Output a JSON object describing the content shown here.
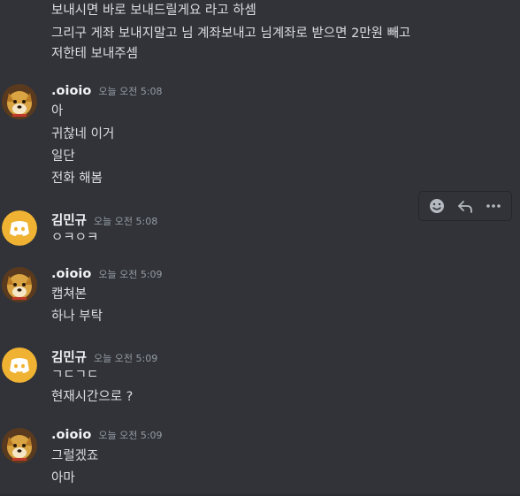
{
  "top_messages": [
    "보내시면 바로 보내드릴게요 라고 하셈",
    "그리구 게좌 보내지말고 님 계좌보내고 님계좌로 받으면 2만원 빼고",
    "저한테 보내주셈"
  ],
  "groups": [
    {
      "username": ".oioio",
      "timestamp": "오늘 오전 5:08",
      "avatar": "dog-avatar",
      "messages": [
        "아",
        "귀찮네 이거",
        "일단",
        "전화 해봄"
      ]
    },
    {
      "username": "김민규",
      "timestamp": "오늘 오전 5:08",
      "avatar": "discord-avatar",
      "messages": [
        "ㅇㅋㅇㅋ"
      ]
    },
    {
      "username": ".oioio",
      "timestamp": "오늘 오전 5:09",
      "avatar": "dog-avatar",
      "messages": [
        "캡쳐본",
        "하나 부탁"
      ]
    },
    {
      "username": "김민규",
      "timestamp": "오늘 오전 5:09",
      "avatar": "discord-avatar",
      "messages": [
        "ㄱㄷㄱㄷ",
        "현재시간으로 ?"
      ]
    },
    {
      "username": ".oioio",
      "timestamp": "오늘 오전 5:09",
      "avatar": "dog-avatar",
      "messages": [
        "그럴겠죠",
        "아마"
      ]
    }
  ],
  "hover_toolbar": {
    "buttons": [
      "add-reaction-icon",
      "reply-icon",
      "more-options-icon"
    ]
  },
  "colors": {
    "background": "#313338",
    "text": "#dbdee1",
    "username": "#f2f3f5",
    "timestamp": "#949ba4",
    "discord_avatar": "#f0b232"
  }
}
